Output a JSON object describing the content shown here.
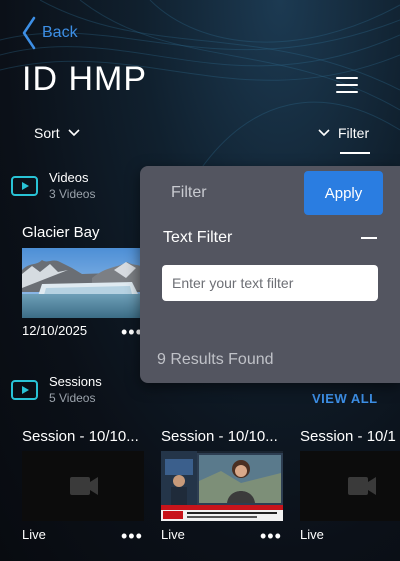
{
  "header": {
    "back_label": "Back",
    "title": "ID HMP",
    "sort_label": "Sort",
    "filter_label": "Filter"
  },
  "videos": {
    "title": "Videos",
    "subtitle": "3 Videos",
    "cards": [
      {
        "title": "Glacier Bay",
        "date": "12/10/2025"
      }
    ]
  },
  "sessions": {
    "title": "Sessions",
    "subtitle": "5 Videos",
    "view_all": "VIEW ALL",
    "cards": [
      {
        "title": "Session - 10/10...",
        "status": "Live"
      },
      {
        "title": "Session - 10/10...",
        "status": "Live"
      },
      {
        "title": "Session - 10/1",
        "status": "Live"
      }
    ]
  },
  "filter_panel": {
    "title": "Filter",
    "apply_label": "Apply",
    "text_filter_label": "Text Filter",
    "text_filter_placeholder": "Enter your text filter",
    "text_filter_value": "",
    "results_text": "9 Results Found"
  },
  "colors": {
    "accent": "#2a7de1",
    "link": "#3d8fe6",
    "section_icon": "#29c3d6",
    "popover": "#535560"
  }
}
